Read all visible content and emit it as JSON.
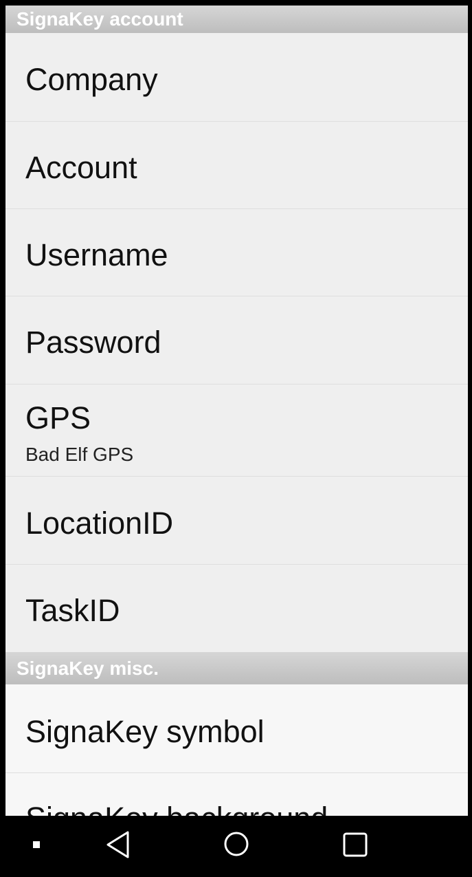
{
  "sections": {
    "account": {
      "header": "SignaKey account",
      "items": [
        {
          "title": "Company"
        },
        {
          "title": "Account"
        },
        {
          "title": "Username"
        },
        {
          "title": "Password"
        },
        {
          "title": "GPS",
          "summary": "Bad Elf GPS"
        },
        {
          "title": "LocationID"
        },
        {
          "title": "TaskID"
        }
      ]
    },
    "misc": {
      "header": "SignaKey misc.",
      "items": [
        {
          "title": "SignaKey symbol"
        },
        {
          "title": "SignaKey background"
        }
      ]
    }
  },
  "navbar": {
    "icons": [
      "square-dot-icon",
      "back-triangle-icon",
      "home-circle-icon",
      "recents-square-icon"
    ]
  }
}
